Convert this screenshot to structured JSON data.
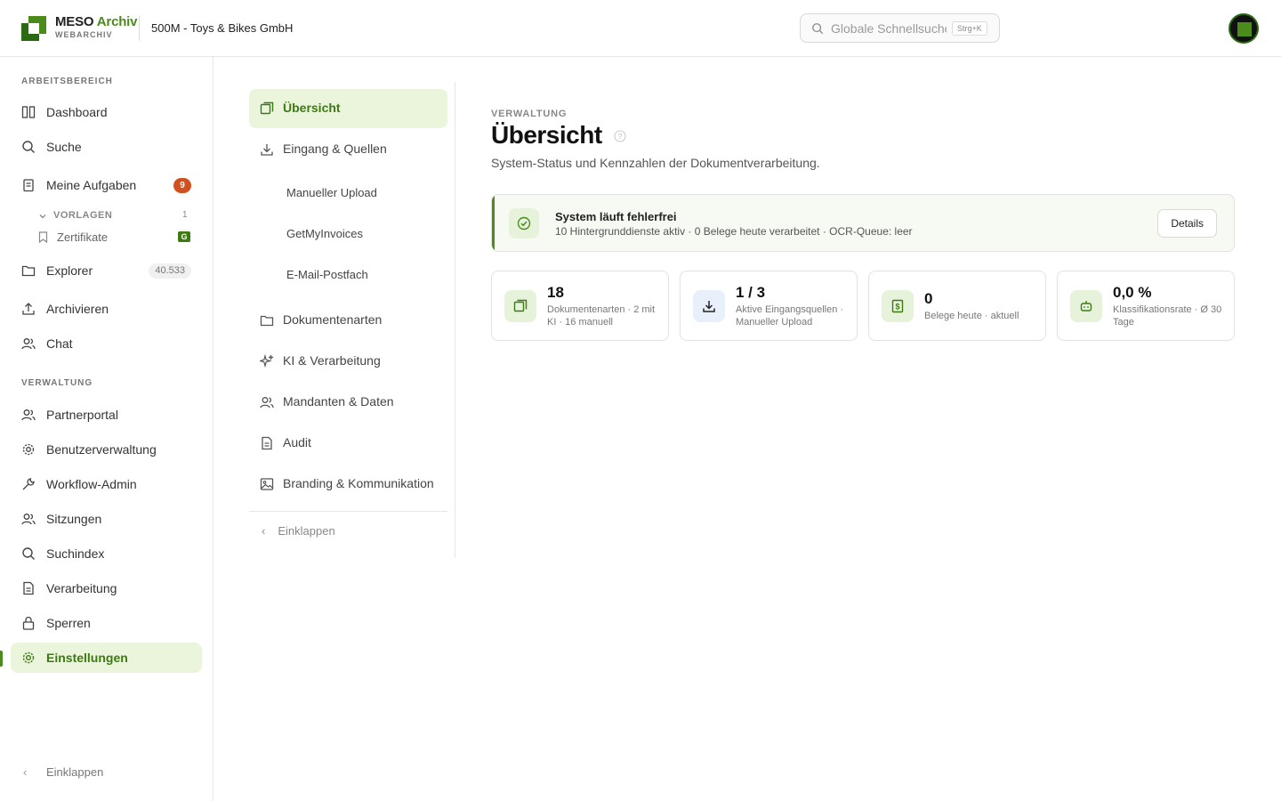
{
  "brand": {
    "name_primary": "MESO",
    "name_accent": "Archiv",
    "subtitle": "WEBARCHIV"
  },
  "tenant": "500M - Toys & Bikes GmbH",
  "search": {
    "placeholder": "Globale Schnellsuche",
    "shortcut": "Strg+K"
  },
  "sidebar": {
    "section_work": "ARBEITSBEREICH",
    "section_admin": "VERWALTUNG",
    "items": [
      {
        "label": "Dashboard",
        "icon": "columns-icon"
      },
      {
        "label": "Suche",
        "icon": "search-icon"
      },
      {
        "label": "Meine Aufgaben",
        "icon": "clipboard-icon",
        "badge": "9"
      },
      {
        "label": "Explorer",
        "icon": "folder-icon",
        "badge": "40.533"
      },
      {
        "label": "Archivieren",
        "icon": "upload-icon"
      },
      {
        "label": "Chat",
        "icon": "users-icon"
      },
      {
        "label": "Partnerportal",
        "icon": "users-icon"
      },
      {
        "label": "Benutzerverwaltung",
        "icon": "gear-icon"
      },
      {
        "label": "Workflow-Admin",
        "icon": "wrench-icon"
      },
      {
        "label": "Sitzungen",
        "icon": "users-icon"
      },
      {
        "label": "Suchindex",
        "icon": "search-icon"
      },
      {
        "label": "Verarbeitung",
        "icon": "document-icon"
      },
      {
        "label": "Sperren",
        "icon": "lock-icon"
      },
      {
        "label": "Einstellungen",
        "icon": "gear-icon"
      }
    ],
    "templates": {
      "label": "VORLAGEN",
      "count": "1"
    },
    "certificates": {
      "label": "Zertifikate",
      "tag": "G"
    },
    "collapse": "Einklappen"
  },
  "subnav": {
    "items": [
      {
        "label": "Übersicht"
      },
      {
        "label": "Eingang & Quellen"
      },
      {
        "label": "Dokumentenarten"
      },
      {
        "label": "KI & Verarbeitung"
      },
      {
        "label": "Mandanten & Daten"
      },
      {
        "label": "Audit"
      },
      {
        "label": "Branding & Kommunikation"
      }
    ],
    "sub_items": [
      "Manueller Upload",
      "GetMyInvoices",
      "E-Mail-Postfach"
    ],
    "collapse": "Einklappen"
  },
  "page": {
    "eyebrow": "VERWALTUNG",
    "title": "Übersicht",
    "lead": "System-Status und Kennzahlen der Dokumentverarbeitung."
  },
  "status": {
    "title": "System läuft fehlerfrei",
    "detail": "10 Hintergrunddienste aktiv · 0 Belege heute verarbeitet · OCR-Queue: leer",
    "button": "Details"
  },
  "cards": [
    {
      "value": "18",
      "desc": "Dokumentenarten · 2 mit KI · 16 manuell"
    },
    {
      "value": "1 / 3",
      "desc": "Aktive Eingangsquellen · Manueller Upload"
    },
    {
      "value": "0",
      "desc": "Belege heute · aktuell"
    },
    {
      "value": "0,0 %",
      "desc": "Klassifikationsrate · Ø 30 Tage"
    }
  ],
  "colors": {
    "accent": "#4b8b1b",
    "badge": "#d2501e",
    "active_bg": "#eaf5dc"
  }
}
